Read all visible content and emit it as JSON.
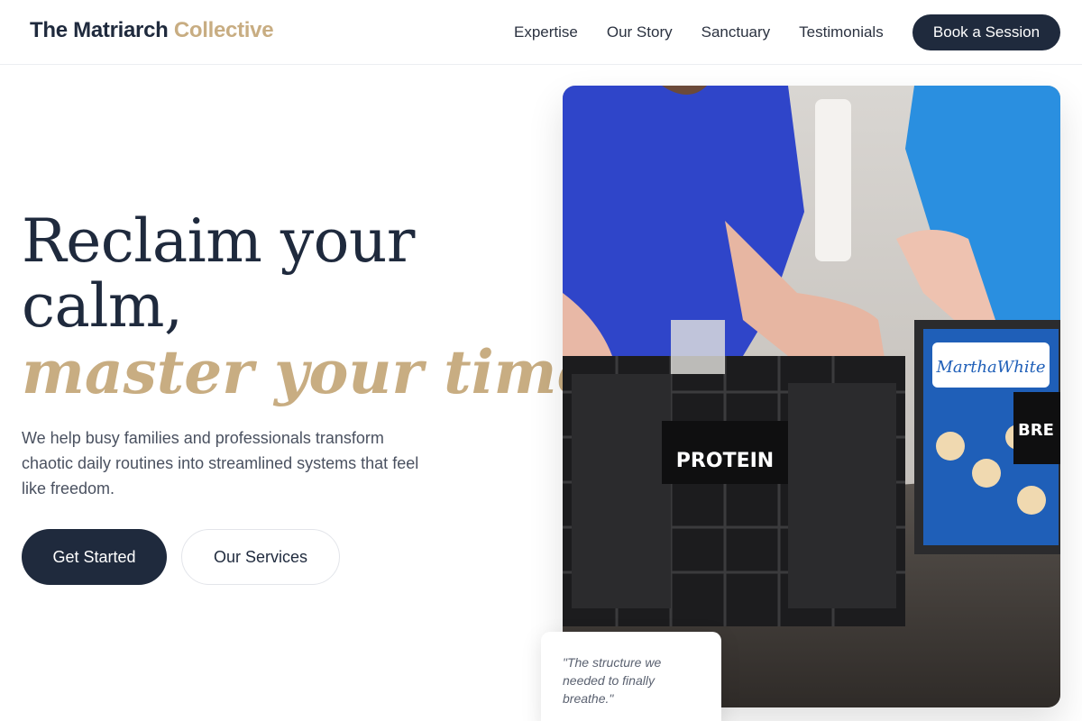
{
  "brand": {
    "name_main": "The Matriarch",
    "name_accent": "Collective"
  },
  "nav": {
    "items": [
      {
        "label": "Expertise"
      },
      {
        "label": "Our Story"
      },
      {
        "label": "Sanctuary"
      },
      {
        "label": "Testimonials"
      }
    ],
    "cta_label": "Book a Session"
  },
  "hero": {
    "headline_line1": "Reclaim your",
    "headline_line2": "calm,",
    "headline_accent": "master your time.",
    "subtext": "We help busy families and professionals transform chaotic daily routines into streamlined systems that feel like freedom.",
    "primary_button": "Get Started",
    "secondary_button": "Our Services"
  },
  "image": {
    "label_protein": "PROTEIN",
    "label_partial": "BRE",
    "label_brand": "MarthaWhite"
  },
  "testimonial": {
    "quote": "\"The structure we needed to finally breathe.\""
  },
  "colors": {
    "navy": "#1f2a3d",
    "gold": "#c8ad82",
    "blue_shirt": "#2f45c9"
  }
}
